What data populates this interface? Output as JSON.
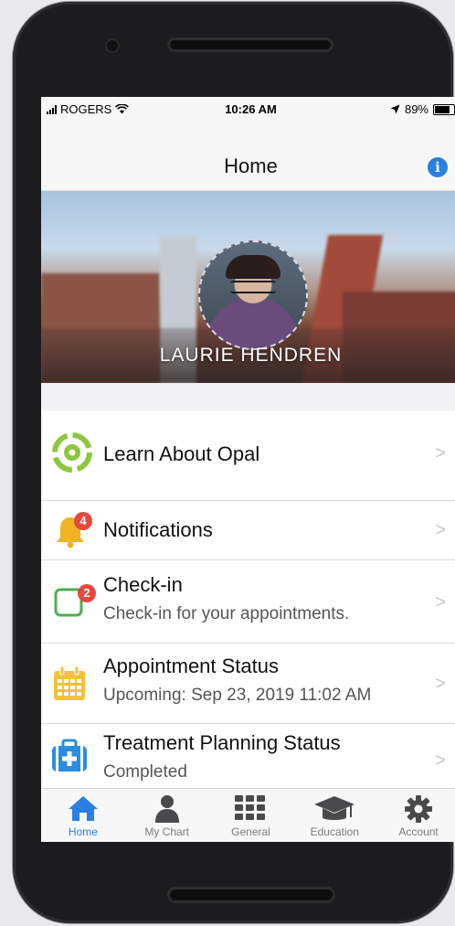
{
  "status_bar": {
    "carrier": "ROGERS",
    "time": "10:26 AM",
    "battery": "89%",
    "battery_level": 0.89
  },
  "nav": {
    "title": "Home",
    "info_icon": "info-icon"
  },
  "profile": {
    "name": "LAURIE HENDREN"
  },
  "menu": [
    {
      "label": "Learn About Opal",
      "icon": "opal-logo-icon"
    },
    {
      "label": "Notifications",
      "icon": "bell-icon",
      "badge": "4"
    },
    {
      "label": "Check-in",
      "subtitle": "Check-in for your appointments.",
      "icon": "checkin-icon",
      "badge": "2"
    },
    {
      "label": "Appointment Status",
      "subtitle": "Upcoming: Sep 23, 2019 11:02 AM",
      "icon": "calendar-icon"
    },
    {
      "label": "Treatment Planning Status",
      "subtitle": "Completed",
      "icon": "medical-kit-icon"
    }
  ],
  "tabs": [
    {
      "label": "Home",
      "icon": "home-icon",
      "active": true
    },
    {
      "label": "My Chart",
      "icon": "person-icon"
    },
    {
      "label": "General",
      "icon": "grid-icon"
    },
    {
      "label": "Education",
      "icon": "graduation-cap-icon"
    },
    {
      "label": "Account",
      "icon": "gear-icon"
    }
  ],
  "colors": {
    "accent": "#2a7fe0",
    "badge": "#e5483d",
    "opal_green": "#8dc63f",
    "bell_yellow": "#f0b323",
    "checkin_green": "#4caf50",
    "calendar_yellow": "#f2c23a",
    "medkit_blue": "#2a8de0"
  }
}
